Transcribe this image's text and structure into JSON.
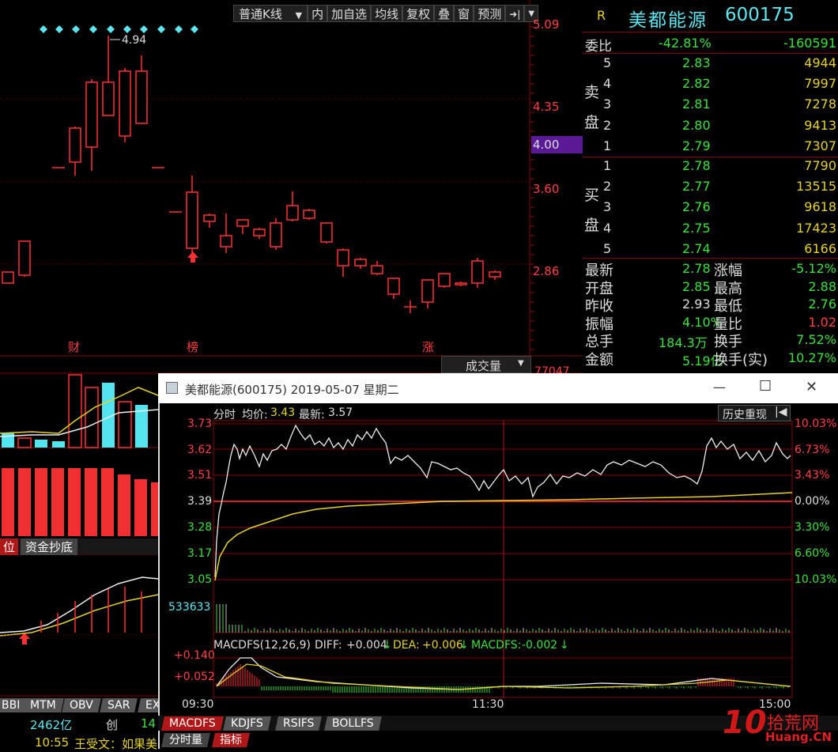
{
  "toolbar": {
    "kline_label": "普通K线",
    "dropdown_arrow": "▼",
    "buttons": [
      "内",
      "加自选",
      "均线",
      "复权",
      "叠",
      "窗",
      "预测"
    ],
    "nav_icon": "➜|",
    "nav_dropdown": "▼"
  },
  "stock": {
    "flag": "R",
    "name": "美都能源",
    "code": "600175"
  },
  "kchart": {
    "price_labels": [
      "5.09",
      "4.35",
      "4.00",
      "3.60",
      "2.86"
    ],
    "high_label": "4.94",
    "event_labels": [
      "财",
      "榜",
      "涨"
    ],
    "volume_selector": "成交量",
    "volume_selector_arrow": "▼",
    "volume_partial": "77047",
    "indicator_tag_left": "位",
    "indicator_tag": "资金抄底",
    "bottom_tabs": [
      "BBI",
      "MTM",
      "OBV",
      "SAR",
      "EX"
    ],
    "amount_value": "2462亿",
    "amount_label": "创",
    "amount_partial": "14",
    "ticker_time": "10:55",
    "ticker_text": "王受文：如果美"
  },
  "quote": {
    "weibi_label": "委比",
    "weibi_pct": "-42.81%",
    "weibi_val": "-160591",
    "sell_label": [
      "卖",
      "盘"
    ],
    "buy_label": [
      "买",
      "盘"
    ],
    "sell": [
      {
        "lvl": "5",
        "price": "2.83",
        "vol": "4944"
      },
      {
        "lvl": "4",
        "price": "2.82",
        "vol": "7997"
      },
      {
        "lvl": "3",
        "price": "2.81",
        "vol": "7278"
      },
      {
        "lvl": "2",
        "price": "2.80",
        "vol": "9413"
      },
      {
        "lvl": "1",
        "price": "2.79",
        "vol": "7307"
      }
    ],
    "buy": [
      {
        "lvl": "1",
        "price": "2.78",
        "vol": "7790"
      },
      {
        "lvl": "2",
        "price": "2.77",
        "vol": "13515"
      },
      {
        "lvl": "3",
        "price": "2.76",
        "vol": "9618"
      },
      {
        "lvl": "4",
        "price": "2.75",
        "vol": "17423"
      },
      {
        "lvl": "5",
        "price": "2.74",
        "vol": "6166"
      }
    ],
    "stats": [
      {
        "l1": "最新",
        "v1": "2.78",
        "l2": "涨幅",
        "v2": "-5.12%"
      },
      {
        "l1": "开盘",
        "v1": "2.85",
        "l2": "最高",
        "v2": "2.88"
      },
      {
        "l1": "昨收",
        "v1": "2.93",
        "l2": "最低",
        "v2": "2.76"
      },
      {
        "l1": "振幅",
        "v1": "4.10%",
        "l2": "量比",
        "v2": "1.02"
      },
      {
        "l1": "总手",
        "v1": "184.3万",
        "l2": "换手",
        "v2": "7.52%"
      },
      {
        "l1": "金额",
        "v1": "5.19亿",
        "l2": "换手(实)",
        "v2": "10.27%"
      }
    ]
  },
  "popup": {
    "title": "美都能源(600175) 2019-05-07 星期二",
    "minimize": "—",
    "maximize": "☐",
    "close": "✕",
    "header_label": "分时",
    "avg_label": "均价:",
    "avg_value": "3.43",
    "last_label": "最新:",
    "last_value": "3.57",
    "replay_button": "历史重现",
    "replay_icon": "|◀",
    "price_axis": [
      "3.73",
      "3.62",
      "3.51",
      "3.39",
      "3.28",
      "3.17",
      "3.05"
    ],
    "pct_axis": [
      "10.03%",
      "6.73%",
      "3.43%",
      "0.00%",
      "3.30%",
      "6.60%",
      "10.03%"
    ],
    "volume_max": "533633",
    "macd_title": "MACDFS(12,26,9)",
    "diff_label": "DIFF:",
    "diff_value": "+0.004",
    "dea_label": "DEA:",
    "dea_value": "+0.006",
    "macdfs_label": "MACDFS:",
    "macdfs_value": "-0.002",
    "down_arrow": "↓",
    "macd_axis": [
      "+0.140",
      "+0.052"
    ],
    "time_axis": [
      "09:30",
      "11:30",
      "15:00"
    ],
    "tabs": [
      "MACDFS",
      "KDJFS",
      "RSIFS",
      "BOLLFS"
    ],
    "bottom_tabs": [
      "分时量",
      "指标"
    ]
  },
  "watermark": {
    "num": "10",
    "text": "拾荒网",
    "url": "Huang.CN"
  },
  "colors": {
    "up": "#ff3030",
    "down": "#54e4f0",
    "grid": "#8a0000",
    "green": "#3ce13c",
    "yellow": "#e6d22a",
    "purple": "#5a1a96"
  }
}
